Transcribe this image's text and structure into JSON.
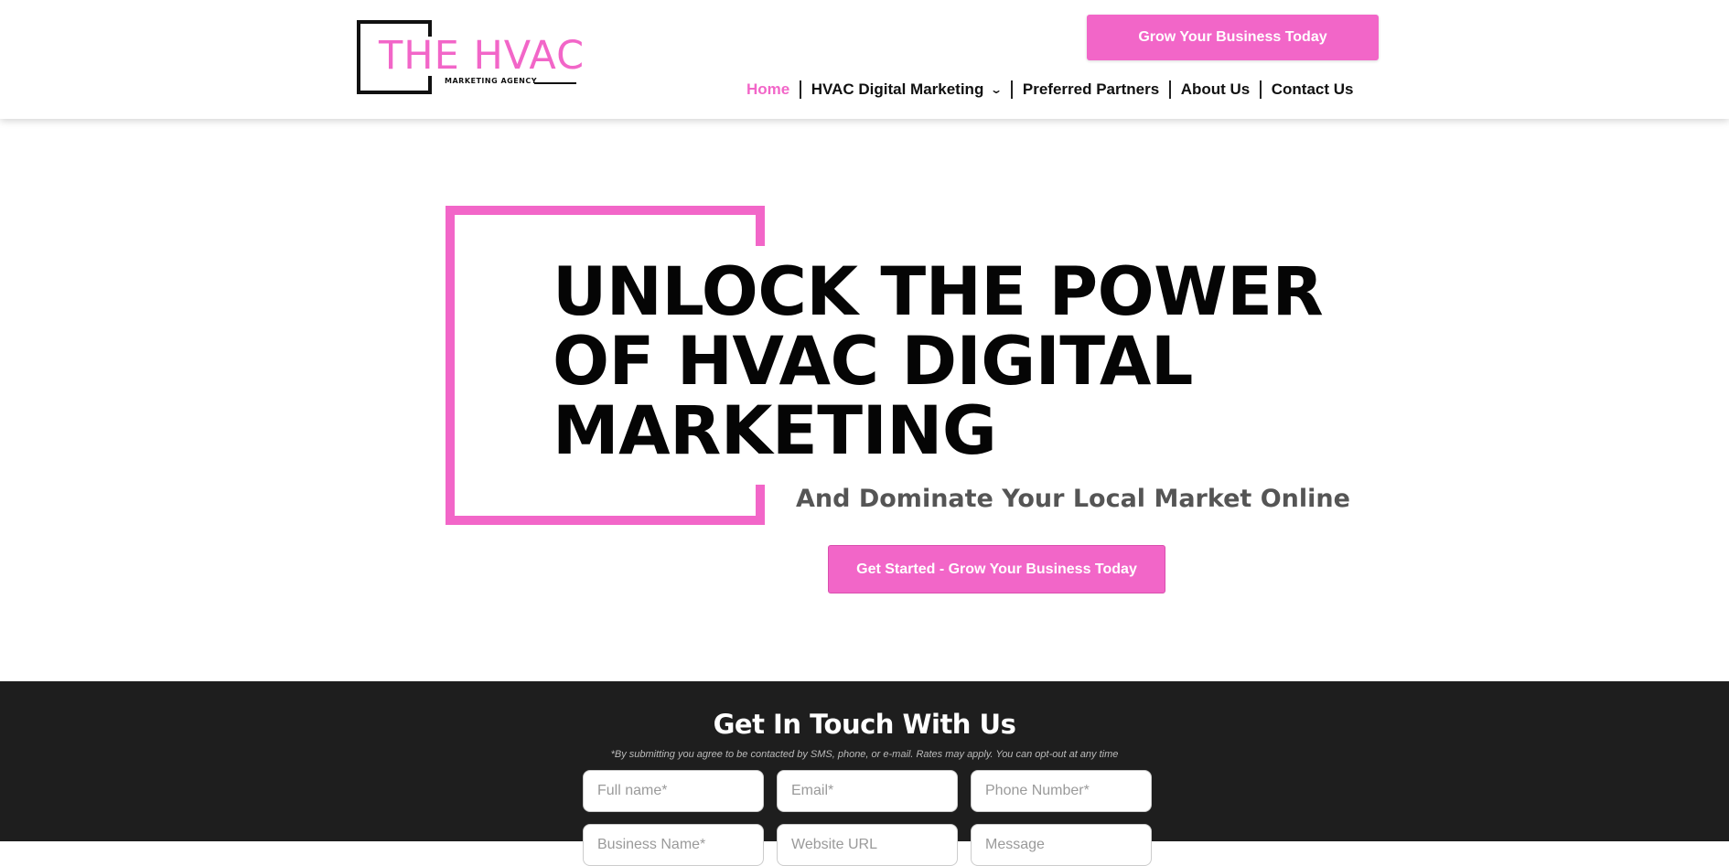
{
  "header": {
    "logo": {
      "title": "THE HVAC",
      "subtitle": "MARKETING AGENCY"
    },
    "cta_label": "Grow Your Business Today",
    "nav": [
      {
        "label": "Home",
        "active": true
      },
      {
        "label": "HVAC Digital Marketing",
        "has_dropdown": true
      },
      {
        "label": "Preferred Partners"
      },
      {
        "label": "About Us"
      },
      {
        "label": "Contact Us"
      }
    ],
    "dropdown_icon": "chevron-down-icon"
  },
  "hero": {
    "headline_lines": [
      "UNLOCK THE POWER",
      "OF HVAC DIGITAL",
      "MARKETING"
    ],
    "subheadline": "And Dominate Your Local Market Online",
    "cta_label": "Get Started - Grow Your Business Today"
  },
  "contact": {
    "title": "Get In Touch With Us",
    "disclaimer": "*By submitting you agree to be contacted by SMS, phone, or e-mail. Rates may apply. You can opt-out at any time",
    "fields": [
      {
        "placeholder": "Full name*",
        "value": ""
      },
      {
        "placeholder": "Email*",
        "value": ""
      },
      {
        "placeholder": "Phone Number*",
        "value": ""
      },
      {
        "placeholder": "Business Name*",
        "value": ""
      },
      {
        "placeholder": "Website URL",
        "value": ""
      },
      {
        "placeholder": "Message",
        "value": ""
      }
    ]
  },
  "colors": {
    "accent": "#f266c8",
    "dark_band": "#1e1e1e",
    "subheadline": "#555555"
  }
}
